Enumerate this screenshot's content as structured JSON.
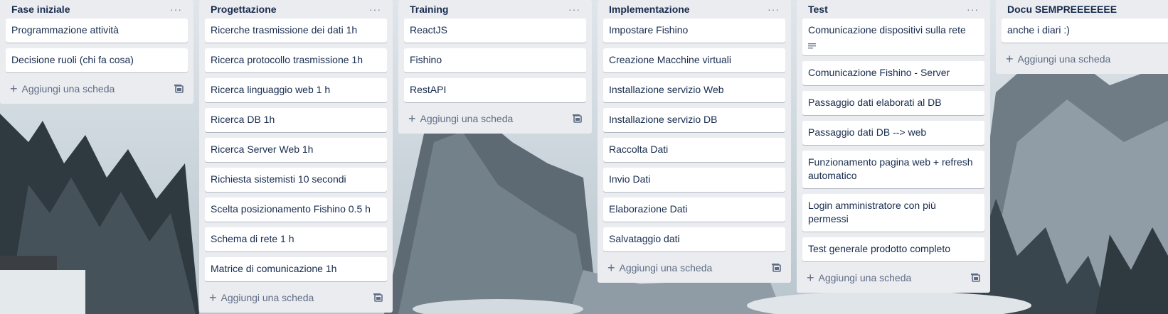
{
  "colors": {
    "list_bg": "#ebecf0",
    "card_bg": "#ffffff",
    "text": "#172b4d",
    "muted": "#5e6c84"
  },
  "lists": [
    {
      "title": "Fase iniziale",
      "cards": [
        "Programmazione attività",
        "Decisione ruoli (chi fa cosa)"
      ],
      "add_label": "Aggiungi una scheda"
    },
    {
      "title": "Progettazione",
      "cards": [
        "Ricerche trasmissione dei dati 1h",
        "Ricerca protocollo trasmissione 1h",
        "Ricerca linguaggio web 1 h",
        "Ricerca DB 1h",
        "Ricerca Server Web 1h",
        "Richiesta sistemisti 10 secondi",
        "Scelta posizionamento Fishino 0.5 h",
        "Schema di rete 1 h",
        "Matrice di comunicazione 1h"
      ],
      "add_label": "Aggiungi una scheda"
    },
    {
      "title": "Training",
      "cards": [
        "ReactJS",
        "Fishino",
        "RestAPI"
      ],
      "add_label": "Aggiungi una scheda"
    },
    {
      "title": "Implementazione",
      "cards": [
        "Impostare Fishino",
        "Creazione Macchine virtuali",
        "Installazione servizio Web",
        "Installazione servizio DB",
        "Raccolta Dati",
        "Invio Dati",
        "Elaborazione Dati",
        "Salvataggio dati"
      ],
      "add_label": "Aggiungi una scheda"
    },
    {
      "title": "Test",
      "cards": [
        "Comunicazione dispositivi sulla rete",
        "Comunicazione Fishino - Server",
        "Passaggio dati elaborati al DB",
        "Passaggio dati DB --> web",
        "Funzionamento pagina web + refresh automatico",
        "Login amministratore con più permessi",
        "Test generale prodotto completo"
      ],
      "add_label": "Aggiungi una scheda"
    },
    {
      "title": "Docu SEMPREEEEEEE",
      "cards": [
        "anche i diari :)"
      ],
      "add_label": "Aggiungi una scheda"
    }
  ]
}
